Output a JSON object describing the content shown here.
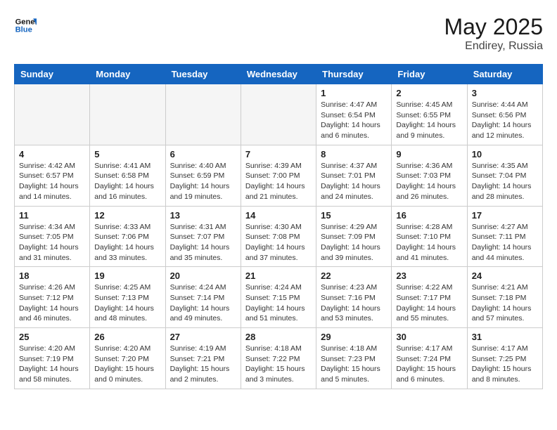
{
  "header": {
    "logo_line1": "General",
    "logo_line2": "Blue",
    "month_year": "May 2025",
    "location": "Endirey, Russia"
  },
  "days_of_week": [
    "Sunday",
    "Monday",
    "Tuesday",
    "Wednesday",
    "Thursday",
    "Friday",
    "Saturday"
  ],
  "weeks": [
    [
      {
        "day": "",
        "info": ""
      },
      {
        "day": "",
        "info": ""
      },
      {
        "day": "",
        "info": ""
      },
      {
        "day": "",
        "info": ""
      },
      {
        "day": "1",
        "info": "Sunrise: 4:47 AM\nSunset: 6:54 PM\nDaylight: 14 hours\nand 6 minutes."
      },
      {
        "day": "2",
        "info": "Sunrise: 4:45 AM\nSunset: 6:55 PM\nDaylight: 14 hours\nand 9 minutes."
      },
      {
        "day": "3",
        "info": "Sunrise: 4:44 AM\nSunset: 6:56 PM\nDaylight: 14 hours\nand 12 minutes."
      }
    ],
    [
      {
        "day": "4",
        "info": "Sunrise: 4:42 AM\nSunset: 6:57 PM\nDaylight: 14 hours\nand 14 minutes."
      },
      {
        "day": "5",
        "info": "Sunrise: 4:41 AM\nSunset: 6:58 PM\nDaylight: 14 hours\nand 16 minutes."
      },
      {
        "day": "6",
        "info": "Sunrise: 4:40 AM\nSunset: 6:59 PM\nDaylight: 14 hours\nand 19 minutes."
      },
      {
        "day": "7",
        "info": "Sunrise: 4:39 AM\nSunset: 7:00 PM\nDaylight: 14 hours\nand 21 minutes."
      },
      {
        "day": "8",
        "info": "Sunrise: 4:37 AM\nSunset: 7:01 PM\nDaylight: 14 hours\nand 24 minutes."
      },
      {
        "day": "9",
        "info": "Sunrise: 4:36 AM\nSunset: 7:03 PM\nDaylight: 14 hours\nand 26 minutes."
      },
      {
        "day": "10",
        "info": "Sunrise: 4:35 AM\nSunset: 7:04 PM\nDaylight: 14 hours\nand 28 minutes."
      }
    ],
    [
      {
        "day": "11",
        "info": "Sunrise: 4:34 AM\nSunset: 7:05 PM\nDaylight: 14 hours\nand 31 minutes."
      },
      {
        "day": "12",
        "info": "Sunrise: 4:33 AM\nSunset: 7:06 PM\nDaylight: 14 hours\nand 33 minutes."
      },
      {
        "day": "13",
        "info": "Sunrise: 4:31 AM\nSunset: 7:07 PM\nDaylight: 14 hours\nand 35 minutes."
      },
      {
        "day": "14",
        "info": "Sunrise: 4:30 AM\nSunset: 7:08 PM\nDaylight: 14 hours\nand 37 minutes."
      },
      {
        "day": "15",
        "info": "Sunrise: 4:29 AM\nSunset: 7:09 PM\nDaylight: 14 hours\nand 39 minutes."
      },
      {
        "day": "16",
        "info": "Sunrise: 4:28 AM\nSunset: 7:10 PM\nDaylight: 14 hours\nand 41 minutes."
      },
      {
        "day": "17",
        "info": "Sunrise: 4:27 AM\nSunset: 7:11 PM\nDaylight: 14 hours\nand 44 minutes."
      }
    ],
    [
      {
        "day": "18",
        "info": "Sunrise: 4:26 AM\nSunset: 7:12 PM\nDaylight: 14 hours\nand 46 minutes."
      },
      {
        "day": "19",
        "info": "Sunrise: 4:25 AM\nSunset: 7:13 PM\nDaylight: 14 hours\nand 48 minutes."
      },
      {
        "day": "20",
        "info": "Sunrise: 4:24 AM\nSunset: 7:14 PM\nDaylight: 14 hours\nand 49 minutes."
      },
      {
        "day": "21",
        "info": "Sunrise: 4:24 AM\nSunset: 7:15 PM\nDaylight: 14 hours\nand 51 minutes."
      },
      {
        "day": "22",
        "info": "Sunrise: 4:23 AM\nSunset: 7:16 PM\nDaylight: 14 hours\nand 53 minutes."
      },
      {
        "day": "23",
        "info": "Sunrise: 4:22 AM\nSunset: 7:17 PM\nDaylight: 14 hours\nand 55 minutes."
      },
      {
        "day": "24",
        "info": "Sunrise: 4:21 AM\nSunset: 7:18 PM\nDaylight: 14 hours\nand 57 minutes."
      }
    ],
    [
      {
        "day": "25",
        "info": "Sunrise: 4:20 AM\nSunset: 7:19 PM\nDaylight: 14 hours\nand 58 minutes."
      },
      {
        "day": "26",
        "info": "Sunrise: 4:20 AM\nSunset: 7:20 PM\nDaylight: 15 hours\nand 0 minutes."
      },
      {
        "day": "27",
        "info": "Sunrise: 4:19 AM\nSunset: 7:21 PM\nDaylight: 15 hours\nand 2 minutes."
      },
      {
        "day": "28",
        "info": "Sunrise: 4:18 AM\nSunset: 7:22 PM\nDaylight: 15 hours\nand 3 minutes."
      },
      {
        "day": "29",
        "info": "Sunrise: 4:18 AM\nSunset: 7:23 PM\nDaylight: 15 hours\nand 5 minutes."
      },
      {
        "day": "30",
        "info": "Sunrise: 4:17 AM\nSunset: 7:24 PM\nDaylight: 15 hours\nand 6 minutes."
      },
      {
        "day": "31",
        "info": "Sunrise: 4:17 AM\nSunset: 7:25 PM\nDaylight: 15 hours\nand 8 minutes."
      }
    ]
  ]
}
